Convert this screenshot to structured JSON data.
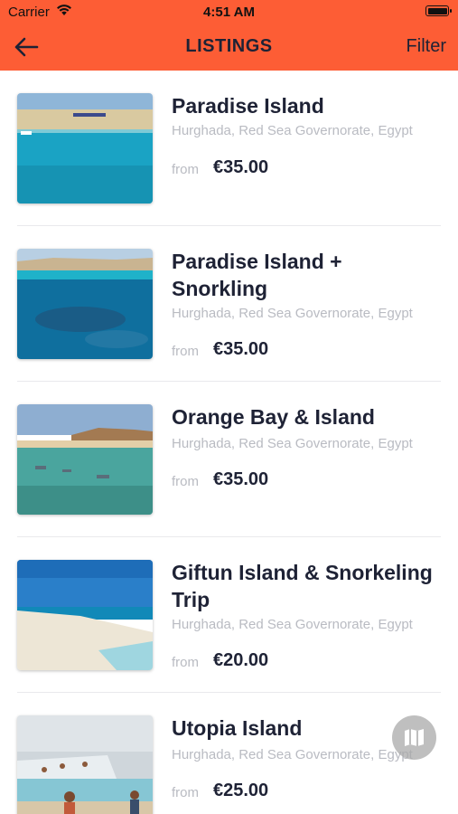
{
  "status_bar": {
    "carrier": "Carrier",
    "time": "4:51 AM"
  },
  "header": {
    "title": "LISTINGS",
    "filter_label": "Filter"
  },
  "colors": {
    "header_bg": "#fd5d35",
    "text_dark": "#1e2235",
    "text_muted": "#b9bbc2"
  },
  "listings": [
    {
      "title": "Paradise Island",
      "location": "Hurghada, Red Sea Governorate, Egypt",
      "from_label": "from",
      "price": "€35.00"
    },
    {
      "title": "Paradise Island + Snorkling",
      "location": "Hurghada, Red Sea Governorate, Egypt",
      "from_label": "from",
      "price": "€35.00"
    },
    {
      "title": "Orange Bay & Island",
      "location": "Hurghada, Red Sea Governorate, Egypt",
      "from_label": "from",
      "price": "€35.00"
    },
    {
      "title": "Giftun Island & Snorkeling Trip",
      "location": "Hurghada, Red Sea Governorate, Egypt",
      "from_label": "from",
      "price": "€20.00"
    },
    {
      "title": "Utopia Island",
      "location": "Hurghada, Red Sea Governorate, Egypt",
      "from_label": "from",
      "price": "€25.00"
    }
  ],
  "icons": {
    "back": "arrow-left-icon",
    "map": "map-icon"
  }
}
